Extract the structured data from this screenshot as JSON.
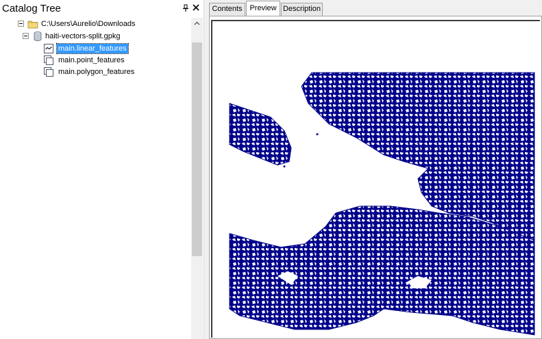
{
  "catalog": {
    "title": "Catalog Tree",
    "tree": [
      {
        "label": "C:\\Users\\Aurelio\\Downloads",
        "icon": "folder-icon",
        "expanded": true
      },
      {
        "label": "haiti-vectors-split.gpkg",
        "icon": "geopackage-icon",
        "expanded": true
      },
      {
        "label": "main.linear_features",
        "icon": "line-feature-class-icon",
        "selected": true
      },
      {
        "label": "main.point_features",
        "icon": "feature-class-icon"
      },
      {
        "label": "main.polygon_features",
        "icon": "feature-class-icon"
      }
    ]
  },
  "tabs": [
    {
      "label": "Contents",
      "active": false
    },
    {
      "label": "Preview",
      "active": true
    },
    {
      "label": "Description",
      "active": false
    }
  ],
  "colors": {
    "selection": "#3399ff",
    "map_features": "#00008b",
    "folder": "#e8c35c"
  }
}
